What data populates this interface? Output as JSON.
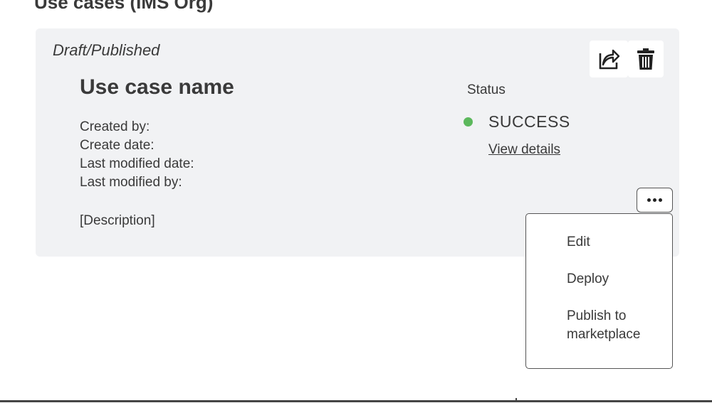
{
  "page": {
    "title": "Use cases (IMS Org)"
  },
  "card": {
    "state": "Draft/Published",
    "name": "Use case name",
    "meta": {
      "created_by": "Created by:",
      "create_date": "Create date:",
      "last_modified_date": "Last modified date:",
      "last_modified_by": "Last modified by:"
    },
    "description": "[Description]",
    "status": {
      "heading": "Status",
      "value": "SUCCESS",
      "color": "#5cb85c",
      "link": "View details"
    },
    "actions": {
      "share_icon": "share-icon",
      "delete_icon": "trash-icon",
      "more_icon": "more-horizontal-icon"
    }
  },
  "menu": {
    "items": [
      {
        "label": "Edit"
      },
      {
        "label": "Deploy"
      },
      {
        "label": "Publish to marketplace"
      }
    ]
  }
}
